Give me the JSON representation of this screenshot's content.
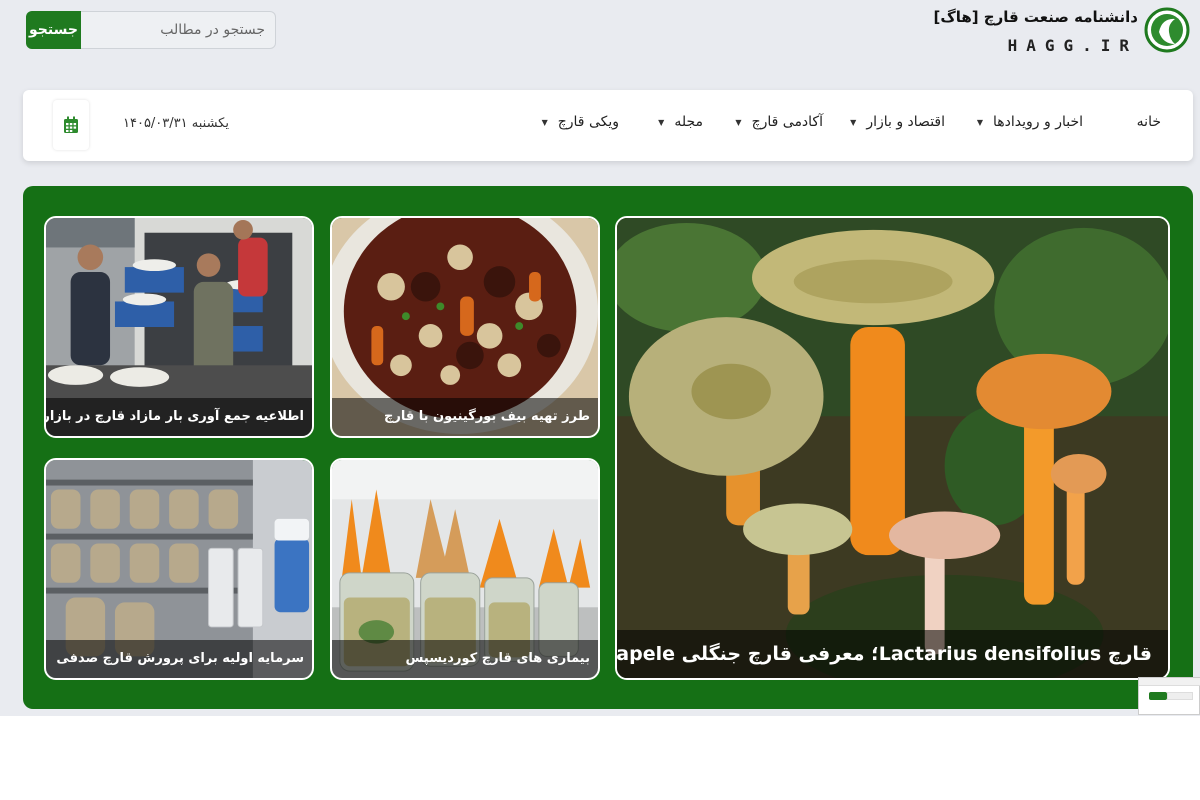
{
  "header": {
    "search_button": "جستجو",
    "search_placeholder": "جستجو در مطالب",
    "logo_title": "دانشنامه صنعت قارچ [هاگ]",
    "logo_sub": "HAGG.IR"
  },
  "nav": {
    "items": [
      {
        "label": "خانه",
        "dropdown": false
      },
      {
        "label": "اخبار و رویدادها",
        "dropdown": true
      },
      {
        "label": "اقتصاد و بازار",
        "dropdown": true
      },
      {
        "label": "آکادمی قارچ",
        "dropdown": true
      },
      {
        "label": "مجله",
        "dropdown": true
      },
      {
        "label": "ویکی قارچ",
        "dropdown": true
      }
    ],
    "date": "یکشنبه ۱۴۰۵/۰۳/۳۱",
    "calendar_icon": "calendar-icon"
  },
  "featured": {
    "main": "قارچ Lactarius densifolius؛ معرفی قارچ جنگلی Namapele",
    "cards": [
      "طرز تهیه بیف بورگینیون با قارچ",
      "اطلاعیه جمع آوری بار مازاد قارچ در بازار",
      "بیماری های قارچ کوردیسپس",
      "سرمایه اولیه برای پرورش قارچ صدفی"
    ]
  },
  "colors": {
    "brand_green": "#1f7a1f",
    "featured_bg": "#157015",
    "page_bg": "#e9ebf0"
  }
}
